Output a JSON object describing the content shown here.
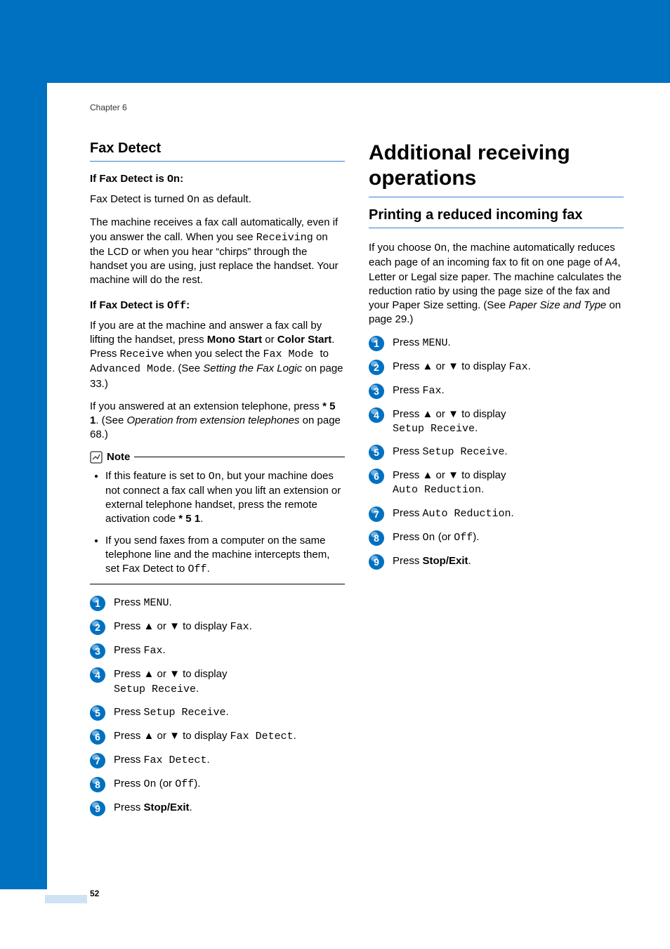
{
  "chapter": "Chapter 6",
  "page_number": "52",
  "left": {
    "title": "Fax Detect",
    "sub1_title_prefix": "If Fax Detect is ",
    "sub1_title_mono": "On",
    "sub1_title_suffix": ":",
    "sub1_p1_a": "Fax Detect is turned ",
    "sub1_p1_b": "On",
    "sub1_p1_c": " as default.",
    "sub1_p2_a": "The machine receives a fax call automatically, even if you answer the call. When you see ",
    "sub1_p2_b": "Receiving",
    "sub1_p2_c": " on the LCD or when you hear “chirps” through the handset you are using, just replace the handset. Your machine will do the rest.",
    "sub2_title_prefix": "If Fax Detect is ",
    "sub2_title_mono": "Off",
    "sub2_title_suffix": ":",
    "sub2_p1_a": "If you are at the machine and answer a fax call by lifting the handset, press ",
    "sub2_p1_b": "Mono Start",
    "sub2_p1_c": " or ",
    "sub2_p1_d": "Color Start",
    "sub2_p1_e": ". Press ",
    "sub2_p1_f": "Receive",
    "sub2_p1_g": " when you select the ",
    "sub2_p1_h": " Fax Mode ",
    "sub2_p1_i": "to ",
    "sub2_p1_j": "Advanced Mode",
    "sub2_p1_k": ". (See ",
    "sub2_p1_l": "Setting the Fax Logic",
    "sub2_p1_m": " on page 33.)",
    "sub2_p2_a": "If you answered at an extension telephone, press ",
    "sub2_p2_b": "* 5 1",
    "sub2_p2_c": ". (See ",
    "sub2_p2_d": "Operation from extension telephones",
    "sub2_p2_e": " on page 68.)",
    "note_label": "Note",
    "note_li1_a": "If this feature is set to ",
    "note_li1_b": "On",
    "note_li1_c": ", but your machine does not connect a fax call when you lift an extension or external telephone handset, press the remote activation code ",
    "note_li1_d": "* 5 1",
    "note_li1_e": ".",
    "note_li2_a": "If you send faxes from a computer on the same telephone line and the machine intercepts them, set Fax Detect to ",
    "note_li2_b": "Off",
    "note_li2_c": ".",
    "steps": {
      "s1_a": "Press ",
      "s1_b": "MENU",
      "s1_c": ".",
      "s2_a": "Press ",
      "s2_b": "a",
      "s2_c": " or ",
      "s2_d": "b",
      "s2_e": " to display ",
      "s2_f": "Fax",
      "s2_g": ".",
      "s3_a": "Press ",
      "s3_b": "Fax",
      "s3_c": ".",
      "s4_a": "Press ",
      "s4_b": "a",
      "s4_c": " or ",
      "s4_d": "b",
      "s4_e": " to display ",
      "s4_f": "Setup Receive",
      "s4_g": ".",
      "s5_a": "Press ",
      "s5_b": "Setup Receive",
      "s5_c": ".",
      "s6_a": "Press ",
      "s6_b": "a",
      "s6_c": " or ",
      "s6_d": "b",
      "s6_e": " to display ",
      "s6_f": "Fax Detect",
      "s6_g": ".",
      "s7_a": "Press ",
      "s7_b": "Fax Detect",
      "s7_c": ".",
      "s8_a": "Press ",
      "s8_b": "On",
      "s8_c": " (or ",
      "s8_d": "Off",
      "s8_e": ").",
      "s9_a": "Press ",
      "s9_b": "Stop/Exit",
      "s9_c": "."
    }
  },
  "right": {
    "title": "Additional receiving operations",
    "subtitle": "Printing a reduced incoming fax",
    "p1_a": "If you choose ",
    "p1_b": "On",
    "p1_c": ", the machine automatically reduces each page of an incoming fax to fit on one page of A4, Letter or Legal size paper. The machine calculates the reduction ratio by using the page size of the fax and your Paper Size setting. (See ",
    "p1_d": "Paper Size and Type",
    "p1_e": " on page 29.)",
    "steps": {
      "s1_a": "Press ",
      "s1_b": "MENU",
      "s1_c": ".",
      "s2_a": "Press ",
      "s2_b": "a",
      "s2_c": " or ",
      "s2_d": "b",
      "s2_e": " to display ",
      "s2_f": "Fax",
      "s2_g": ".",
      "s3_a": "Press ",
      "s3_b": "Fax",
      "s3_c": ".",
      "s4_a": "Press ",
      "s4_b": "a",
      "s4_c": " or ",
      "s4_d": "b",
      "s4_e": " to display ",
      "s4_f": "Setup Receive",
      "s4_g": ".",
      "s5_a": "Press ",
      "s5_b": "Setup Receive",
      "s5_c": ".",
      "s6_a": "Press ",
      "s6_b": "a",
      "s6_c": " or ",
      "s6_d": "b",
      "s6_e": " to display ",
      "s6_f": "Auto Reduction",
      "s6_g": ".",
      "s7_a": "Press ",
      "s7_b": "Auto Reduction",
      "s7_c": ".",
      "s8_a": "Press ",
      "s8_b": "On",
      "s8_c": " (or ",
      "s8_d": "Off",
      "s8_e": ").",
      "s9_a": "Press ",
      "s9_b": "Stop/Exit",
      "s9_c": "."
    }
  },
  "arrows": {
    "up": "▲",
    "down": "▼"
  }
}
